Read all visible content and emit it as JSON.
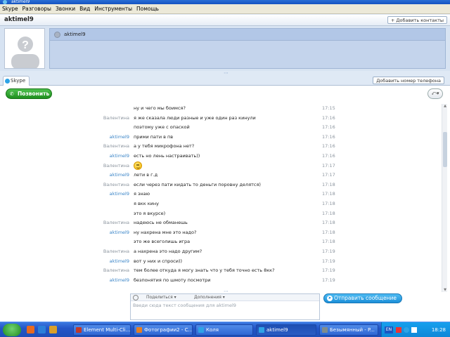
{
  "window": {
    "title": "aktimel9"
  },
  "menu": {
    "items": [
      "Skype",
      "Разговоры",
      "Звонки",
      "Вид",
      "Инструменты",
      "Помощь"
    ]
  },
  "header": {
    "contact_name": "aktimel9",
    "add_contacts_label": "+ Добавить контакты"
  },
  "participants": [
    {
      "name": "aktimel9"
    }
  ],
  "tabs": {
    "skype_label": "Skype",
    "add_phone_label": "Добавить номер телефона"
  },
  "call": {
    "call_label": "Позвонить",
    "menu_symbol": "⤺▾"
  },
  "chat": {
    "messages": [
      {
        "sender": "",
        "me": false,
        "text": "ну и чего мы боимся?",
        "time": "17:15"
      },
      {
        "sender": "Валентина",
        "me": false,
        "text": "я же сказала люди разные и уже один раз кинули",
        "time": "17:16"
      },
      {
        "sender": "",
        "me": false,
        "text": "поэтому уже с опаской",
        "time": "17:16"
      },
      {
        "sender": "aktimel9",
        "me": true,
        "text": "прими пати в пв",
        "time": "17:16"
      },
      {
        "sender": "Валентина",
        "me": false,
        "text": "а у тебя микрофона нет?",
        "time": "17:16"
      },
      {
        "sender": "aktimel9",
        "me": true,
        "text": "есть но лень настраивать))",
        "time": "17:16"
      },
      {
        "sender": "Валентина",
        "me": false,
        "text": "",
        "emoji": true,
        "time": "17:17"
      },
      {
        "sender": "aktimel9",
        "me": true,
        "text": "лети в г.д",
        "time": "17:17"
      },
      {
        "sender": "Валентина",
        "me": false,
        "text": "если через пати кидать то деньги поровну делятся)",
        "time": "17:18"
      },
      {
        "sender": "aktimel9",
        "me": true,
        "text": "я знаю",
        "time": "17:18"
      },
      {
        "sender": "",
        "me": false,
        "text": "я вкк кину",
        "time": "17:18"
      },
      {
        "sender": "",
        "me": false,
        "text": "это я вкурсе)",
        "time": "17:18"
      },
      {
        "sender": "Валентина",
        "me": false,
        "text": "надеюсь не обманешь",
        "time": "17:18"
      },
      {
        "sender": "aktimel9",
        "me": true,
        "text": "ну нахрена мне это надо?",
        "time": "17:18"
      },
      {
        "sender": "",
        "me": false,
        "text": "это же всеголишь игра",
        "time": "17:18"
      },
      {
        "sender": "Валентина",
        "me": false,
        "text": "а нахрена это надо другим?",
        "time": "17:19"
      },
      {
        "sender": "aktimel9",
        "me": true,
        "text": "вот у них и спроси))",
        "time": "17:19"
      },
      {
        "sender": "Валентина",
        "me": false,
        "text": "тем более откуда я могу знать что у тебя точно есть 8кк?",
        "time": "17:19"
      },
      {
        "sender": "aktimel9",
        "me": true,
        "text": "безпонятия по шмоту посмотри",
        "time": "17:19"
      }
    ]
  },
  "input": {
    "share_label": "Поделиться ▾",
    "extras_label": "Дополнения ▾",
    "placeholder": "Введи сюда текст сообщения для aktimel9",
    "send_label": "Отправить сообщение"
  },
  "taskbar": {
    "tasks": [
      {
        "label": "Element Multi-Cli...",
        "color": "#c0392b"
      },
      {
        "label": "Фотографии2 - С...",
        "color": "#e67e22"
      },
      {
        "label": "Коля",
        "color": "#2ea3e6"
      },
      {
        "label": "aktimel9",
        "color": "#2ea3e6",
        "active": true
      },
      {
        "label": "Безымянный - P...",
        "color": "#7f8c8d"
      }
    ],
    "lang": "EN",
    "clock": "18:28"
  }
}
